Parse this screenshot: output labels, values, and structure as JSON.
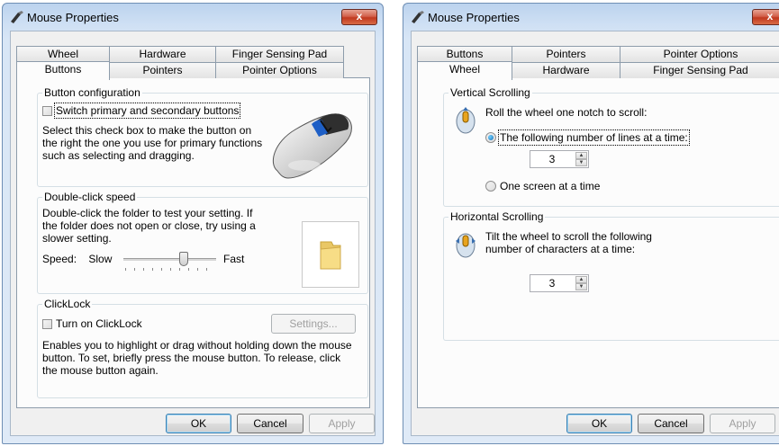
{
  "left_window": {
    "title": "Mouse Properties",
    "close_label": "x",
    "tabs_back": [
      "Wheel",
      "Hardware",
      "Finger Sensing Pad"
    ],
    "tabs_front": [
      "Buttons",
      "Pointers",
      "Pointer Options"
    ],
    "button_config": {
      "group_label": "Button configuration",
      "switch_checkbox_label": "Switch primary and secondary buttons",
      "switch_checked": false,
      "description": "Select this check box to make the button on the right the one you use for primary functions such as selecting and dragging."
    },
    "double_click": {
      "group_label": "Double-click speed",
      "description": "Double-click the folder to test your setting. If the folder does not open or close, try using a slower setting.",
      "speed_label": "Speed:",
      "slow_label": "Slow",
      "fast_label": "Fast",
      "slider_value": 0.67
    },
    "clicklock": {
      "group_label": "ClickLock",
      "checkbox_label": "Turn on ClickLock",
      "checked": false,
      "settings_button": "Settings...",
      "description": "Enables you to highlight or drag without holding down the mouse button. To set, briefly press the mouse button. To release, click the mouse button again."
    },
    "footer": {
      "ok": "OK",
      "cancel": "Cancel",
      "apply": "Apply"
    }
  },
  "right_window": {
    "title": "Mouse Properties",
    "close_label": "x",
    "tabs_back": [
      "Buttons",
      "Pointers",
      "Pointer Options"
    ],
    "tabs_front": [
      "Wheel",
      "Hardware",
      "Finger Sensing Pad"
    ],
    "vertical": {
      "group_label": "Vertical Scrolling",
      "instruction": "Roll the wheel one notch to scroll:",
      "option_lines": "The following number of lines at a time:",
      "lines_value": "3",
      "option_screen": "One screen at a time",
      "selected": "lines"
    },
    "horizontal": {
      "group_label": "Horizontal Scrolling",
      "instruction": "Tilt the wheel to scroll the following number of characters at a time:",
      "chars_value": "3"
    },
    "footer": {
      "ok": "OK",
      "cancel": "Cancel",
      "apply": "Apply"
    }
  },
  "colors": {
    "title_gradient_top": "#bcd3ee",
    "close_red": "#c0391f",
    "panel_bg": "#fcfcfc",
    "dialog_bg": "#f0f0f0"
  }
}
